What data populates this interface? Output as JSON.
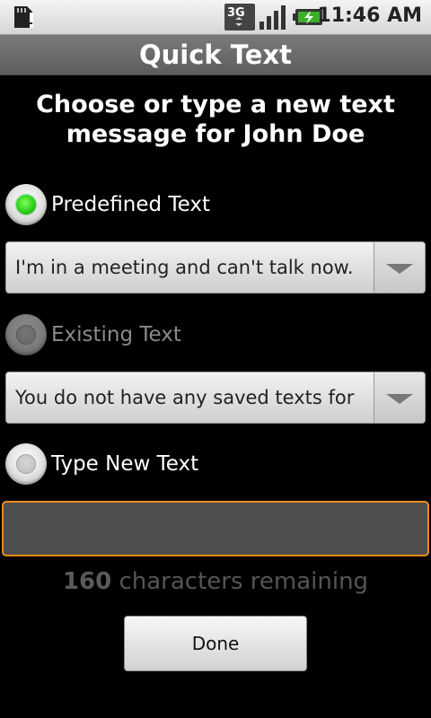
{
  "status_bar": {
    "time": "11:46 AM",
    "network": "3G",
    "icons": [
      "sdcard-alert-icon",
      "3g-data-icon",
      "signal-icon",
      "battery-charging-icon"
    ]
  },
  "title": "Quick Text",
  "heading": "Choose or type a new text message for John Doe",
  "options": [
    {
      "label": "Predefined Text",
      "selected": true,
      "enabled": true,
      "value": "I'm in a meeting and can't talk now."
    },
    {
      "label": "Existing Text",
      "selected": false,
      "enabled": false,
      "value": "You do not have any saved texts for"
    },
    {
      "label": "Type New Text",
      "selected": false,
      "enabled": true,
      "value": ""
    }
  ],
  "counter": {
    "count": "160",
    "text": "characters remaining"
  },
  "done_label": "Done",
  "colors": {
    "focus_border": "#f08c1a",
    "radio_on": "#2ed11a"
  }
}
